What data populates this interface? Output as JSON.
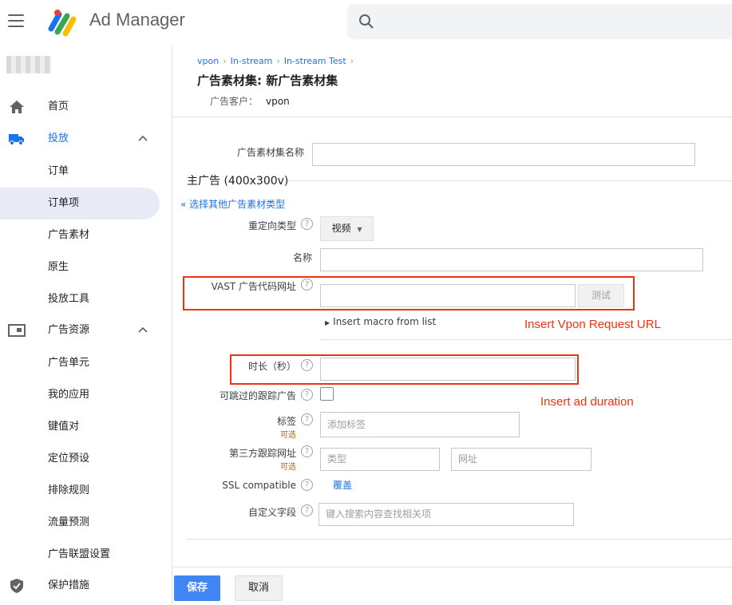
{
  "header": {
    "app_title": "Ad Manager",
    "menu_icon": "hamburger-menu-icon",
    "logo_icon": "ad-manager-logo",
    "search_icon": "search-icon"
  },
  "sidebar": {
    "items": [
      {
        "label": "首页",
        "icon": "home-icon"
      },
      {
        "label": "投放",
        "icon": "truck-icon",
        "expanded": true
      },
      {
        "label": "订单"
      },
      {
        "label": "订单项",
        "selected": true
      },
      {
        "label": "广告素材"
      },
      {
        "label": "原生"
      },
      {
        "label": "投放工具"
      },
      {
        "label": "广告资源",
        "icon": "inventory-icon",
        "expanded": true
      },
      {
        "label": "广告单元"
      },
      {
        "label": "我的应用"
      },
      {
        "label": "键值对"
      },
      {
        "label": "定位预设"
      },
      {
        "label": "排除规则"
      },
      {
        "label": "流量预测"
      },
      {
        "label": "广告联盟设置"
      },
      {
        "label": "保护措施",
        "icon": "shield-icon"
      }
    ]
  },
  "main": {
    "breadcrumb": [
      "vpon",
      "In-stream",
      "In-stream Test"
    ],
    "title": "广告素材集: 新广告素材集",
    "advertiser_label": "广告客户：",
    "advertiser_value": "vpon",
    "form": {
      "creative_set_name_label": "广告素材集名称",
      "master_section_title": "主广告 (400x300v)",
      "choose_other_type_link": "« 选择其他广告素材类型",
      "redirect_type_label": "重定向类型",
      "redirect_type_value": "视频",
      "name_label": "名称",
      "vast_label": "VAST 广告代码网址",
      "test_button": "测试",
      "insert_macro_link": "Insert macro from list",
      "duration_label": "时长（秒）",
      "skippable_label": "可跳过的跟踪广告",
      "labels_label": "标签",
      "optional": "可选",
      "labels_placeholder": "添加标签",
      "third_party_label": "第三方跟踪网址",
      "type_placeholder": "类型",
      "url_placeholder": "网址",
      "ssl_label": "SSL compatible",
      "ssl_value": "覆盖",
      "custom_fields_label": "自定义字段",
      "custom_fields_placeholder": "键入搜索内容查找相关项"
    },
    "annotations": {
      "vast": "Insert Vpon Request URL",
      "duration": "Insert ad duration"
    },
    "actions": {
      "save": "保存",
      "cancel": "取消"
    }
  },
  "colors": {
    "accent": "#1a73e8",
    "annotation": "#ee3311",
    "save_button": "#4285f4"
  }
}
